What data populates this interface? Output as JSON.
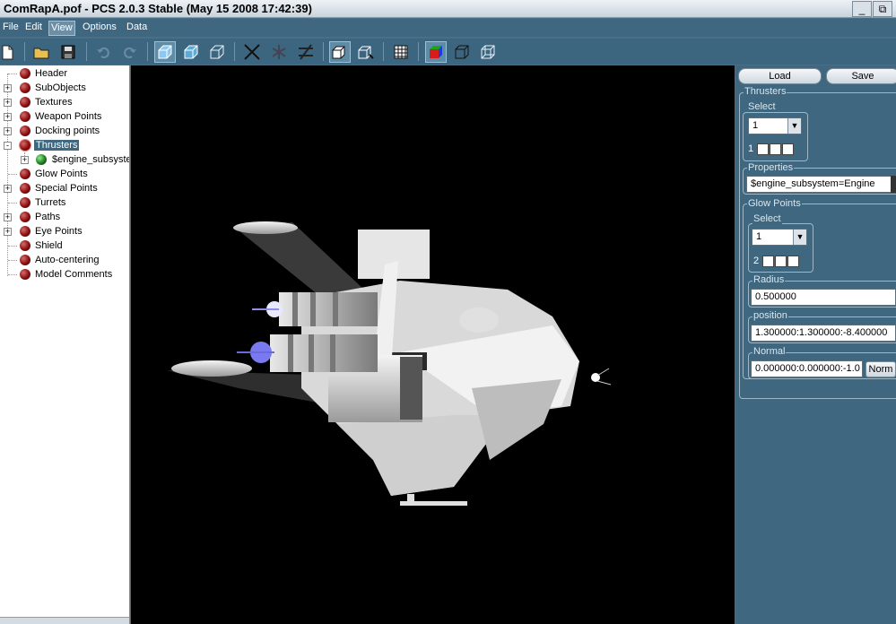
{
  "window": {
    "title": "ComRapA.pof - PCS 2.0.3 Stable (May 15 2008 17:42:39)",
    "minimize_glyph": "_",
    "restore_glyph": "⧉"
  },
  "menu": [
    {
      "label": "File"
    },
    {
      "label": "Edit"
    },
    {
      "label": "View"
    },
    {
      "label": "Options"
    },
    {
      "label": "Data"
    }
  ],
  "toolbar": {
    "icons": [
      "new-file-icon",
      "open-folder-icon",
      "save-disk-icon",
      "undo-icon",
      "redo-icon",
      "solid-view-icon",
      "textured-view-icon",
      "wireframe-view-icon",
      "cross-axis-icon",
      "scatter-icon",
      "slash-icon",
      "box-front-icon",
      "box-back-icon",
      "grid-icon",
      "color-cube-icon",
      "cube-outline-icon",
      "cube-wire-icon"
    ]
  },
  "tree": {
    "items": [
      {
        "label": "Header",
        "expander": ""
      },
      {
        "label": "SubObjects",
        "expander": "+"
      },
      {
        "label": "Textures",
        "expander": "+"
      },
      {
        "label": "Weapon Points",
        "expander": "+"
      },
      {
        "label": "Docking points",
        "expander": "+"
      },
      {
        "label": "Thrusters",
        "expander": "-"
      },
      {
        "label": "$engine_subsystem",
        "expander": "+"
      },
      {
        "label": "Glow Points",
        "expander": ""
      },
      {
        "label": "Special Points",
        "expander": "+"
      },
      {
        "label": "Turrets",
        "expander": ""
      },
      {
        "label": "Paths",
        "expander": "+"
      },
      {
        "label": "Eye Points",
        "expander": "+"
      },
      {
        "label": "Shield",
        "expander": ""
      },
      {
        "label": "Auto-centering",
        "expander": ""
      },
      {
        "label": "Model Comments",
        "expander": ""
      }
    ]
  },
  "panel": {
    "load_label": "Load",
    "save_label": "Save",
    "thrusters_label": "Thrusters",
    "select_label": "Select",
    "thruster_select_value": "1",
    "thruster_index": "1",
    "properties_label": "Properties",
    "properties_value": "$engine_subsystem=Engine",
    "glow_points_label": "Glow Points",
    "glow_select_label": "Select",
    "glow_select_value": "1",
    "glow_index": "2",
    "radius_label": "Radius",
    "radius_value": "0.500000",
    "position_label": "position",
    "position_value": "1.300000:1.300000:-8.400000",
    "normal_label": "Normal",
    "normal_value": "0.000000:0.000000:-1.0",
    "norm_button": "Norm"
  }
}
